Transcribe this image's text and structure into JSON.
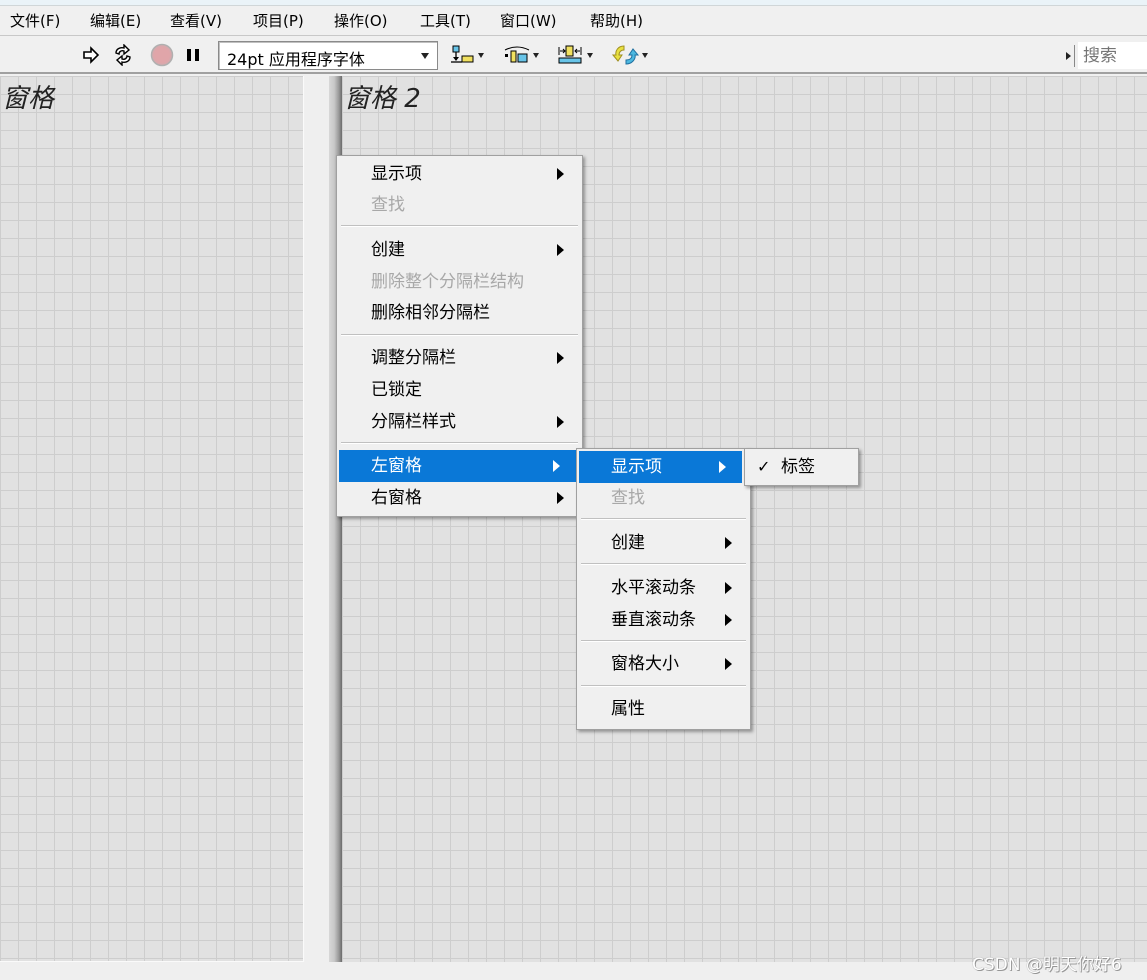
{
  "menubar": {
    "items": [
      {
        "label": "文件(F)"
      },
      {
        "label": "编辑(E)"
      },
      {
        "label": "查看(V)"
      },
      {
        "label": "项目(P)"
      },
      {
        "label": "操作(O)"
      },
      {
        "label": "工具(T)"
      },
      {
        "label": "窗口(W)"
      },
      {
        "label": "帮助(H)"
      }
    ]
  },
  "toolbar": {
    "run_icon": "run-arrow-icon",
    "run_continuously_icon": "run-continuously-icon",
    "abort_icon": "abort-stop-icon",
    "pause_icon": "pause-icon",
    "font_select": "24pt 应用程序字体",
    "align_icon": "align-objects-icon",
    "distribute_icon": "distribute-objects-icon",
    "resize_icon": "resize-objects-icon",
    "reorder_icon": "reorder-icon",
    "search_placeholder": "搜索"
  },
  "panes": {
    "left_label": "窗格",
    "right_label": "窗格 2"
  },
  "context_menu": {
    "items": [
      {
        "label": "显示项",
        "submenu": true,
        "enabled": true
      },
      {
        "label": "查找",
        "submenu": false,
        "enabled": false
      },
      {
        "label": "创建",
        "submenu": true,
        "enabled": true
      },
      {
        "label": "删除整个分隔栏结构",
        "submenu": false,
        "enabled": false
      },
      {
        "label": "删除相邻分隔栏",
        "submenu": false,
        "enabled": true
      },
      {
        "label": "调整分隔栏",
        "submenu": true,
        "enabled": true
      },
      {
        "label": "已锁定",
        "submenu": false,
        "enabled": true
      },
      {
        "label": "分隔栏样式",
        "submenu": true,
        "enabled": true
      },
      {
        "label": "左窗格",
        "submenu": true,
        "enabled": true,
        "highlighted": true
      },
      {
        "label": "右窗格",
        "submenu": true,
        "enabled": true
      }
    ]
  },
  "left_pane_submenu": {
    "items": [
      {
        "label": "显示项",
        "submenu": true,
        "enabled": true,
        "highlighted": true
      },
      {
        "label": "查找",
        "submenu": false,
        "enabled": false
      },
      {
        "label": "创建",
        "submenu": true,
        "enabled": true
      },
      {
        "label": "水平滚动条",
        "submenu": true,
        "enabled": true
      },
      {
        "label": "垂直滚动条",
        "submenu": true,
        "enabled": true
      },
      {
        "label": "窗格大小",
        "submenu": true,
        "enabled": true
      },
      {
        "label": "属性",
        "submenu": false,
        "enabled": true
      }
    ]
  },
  "visible_items_submenu": {
    "items": [
      {
        "label": "标签",
        "checked": true,
        "check_mark": "✓"
      }
    ]
  },
  "watermark": "CSDN @明天你好6",
  "colors": {
    "highlight": "#0a78d7",
    "disabled_text": "#a8a8a8",
    "grid_bg": "#e1e1e1"
  }
}
